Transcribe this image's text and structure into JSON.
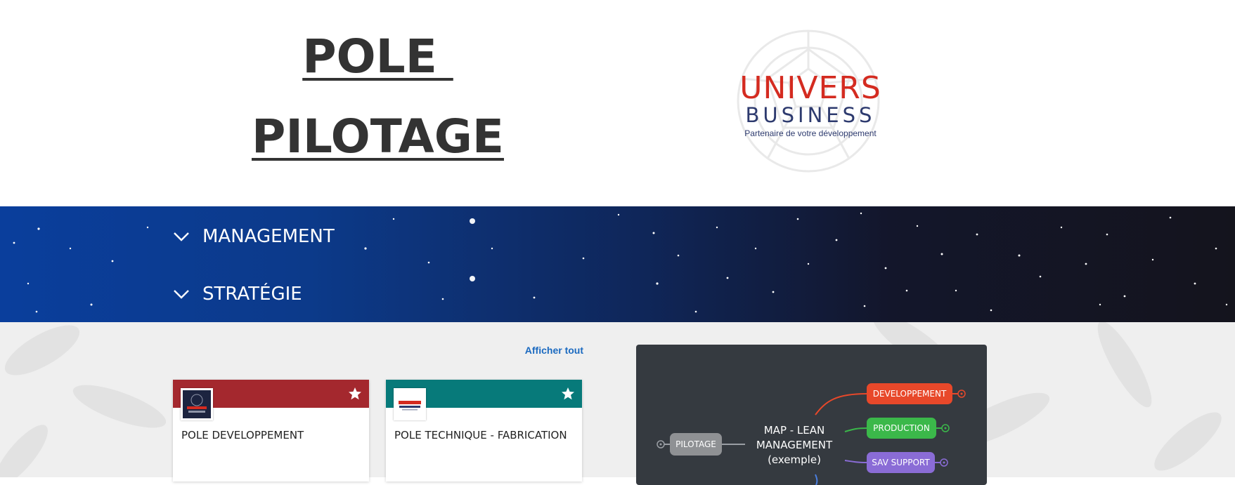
{
  "header": {
    "title_line1": "POLE ",
    "title_line2": "PILOTAGE",
    "logo": {
      "line1": "UNIVERS",
      "line2": "BUSINESS",
      "tagline": "Partenaire de votre développement"
    }
  },
  "accordion": {
    "items": [
      {
        "label": "MANAGEMENT"
      },
      {
        "label": "STRATÉGIE"
      }
    ]
  },
  "content": {
    "show_all": "Afficher tout",
    "cards": [
      {
        "title": "POLE DEVELOPPEMENT",
        "band_color": "#a4282e",
        "starred": true
      },
      {
        "title": "POLE TECHNIQUE - FABRICATION",
        "band_color": "#077a7a",
        "starred": true
      }
    ],
    "mindmap": {
      "root": "PILOTAGE",
      "center": [
        "MAP - LEAN",
        "MANAGEMENT",
        "(exemple)"
      ],
      "branches": [
        {
          "label": "DEVELOPPEMENT",
          "color": "#e8482a"
        },
        {
          "label": "PRODUCTION",
          "color": "#3bb84a"
        },
        {
          "label": "SAV SUPPORT",
          "color": "#8a6cd6"
        }
      ]
    }
  },
  "colors": {
    "banner_left": "#0a3e9c",
    "banner_right": "#14141d",
    "link": "#1b6ac0",
    "mindmap_bg": "#353a40"
  },
  "icons": [
    "chevron-down-icon",
    "star-icon"
  ]
}
